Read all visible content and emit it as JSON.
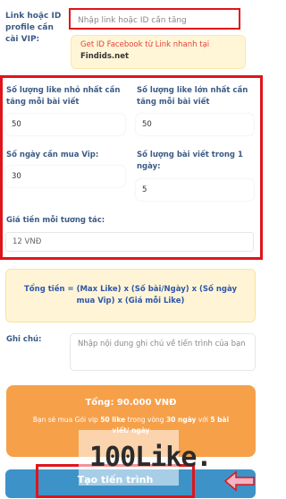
{
  "profile": {
    "label": "Link hoặc ID profile cần cài VIP:",
    "placeholder": "Nhập link hoặc ID cần tăng"
  },
  "fb_note": {
    "line1": "Get ID Facebook từ Link nhanh tại",
    "line2": "Findids.net"
  },
  "vip": {
    "min_like_label": "Số lượng like nhỏ nhất cần tăng mỗi bài viết",
    "min_like_value": "50",
    "max_like_label": "Số lượng like lớn nhất cần tăng mỗi bài viết",
    "max_like_value": "50",
    "days_label": "Số ngày cần mua Vip:",
    "days_value": "30",
    "posts_label": "Số lượng bài viết trong 1 ngày:",
    "posts_value": "5",
    "price_label": "Giá tiền mỗi tương tác:",
    "price_value": "12 VNĐ"
  },
  "formula": "Tổng tiền = (Max Like) x (Số bài/Ngày) x (Số ngày mua Vip) x (Giá mỗi Like)",
  "note": {
    "label": "Ghi chú:",
    "placeholder": "Nhập nội dung ghi chú về tiến trình của bạn"
  },
  "total": {
    "title": "Tổng: 90.000 VNĐ",
    "desc_prefix": "Bạn sẽ mua Gói vip",
    "desc_likes": "50 like",
    "desc_mid": "trong vòng",
    "desc_days": "30 ngày",
    "desc_with": "với",
    "desc_posts": "5 bài viết/ ngày"
  },
  "watermark": "100Like.",
  "create_button": "Tạo tiến trình",
  "colors": {
    "highlight_red": "#e0141b",
    "label_blue": "#3b5a86",
    "total_orange": "#f6a04a",
    "button_blue": "#3d93c8",
    "note_yellow": "#fff5d6"
  }
}
